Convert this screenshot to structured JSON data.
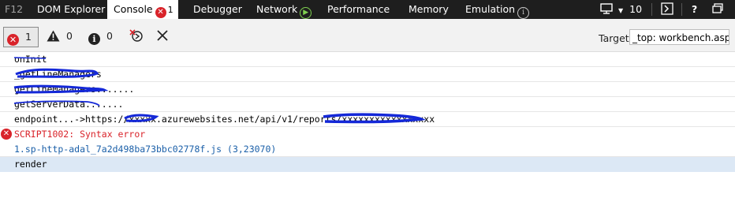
{
  "tabbar": {
    "f12": "F12",
    "tabs": [
      {
        "label": "DOM Explorer"
      },
      {
        "label": "Console",
        "count": "1"
      },
      {
        "label": "Debugger"
      },
      {
        "label": "Network"
      },
      {
        "label": "Performance"
      },
      {
        "label": "Memory"
      },
      {
        "label": "Emulation"
      }
    ],
    "device_count": "10",
    "help": "?"
  },
  "toolbar": {
    "errors_count": "1",
    "warnings_count": "0",
    "info_count": "0",
    "target_label": "Target",
    "target_value": "_top: workbench.aspx"
  },
  "console": {
    "lines": [
      {
        "text": "onInit",
        "type": "log"
      },
      {
        "text": "_getLineManagers",
        "type": "log"
      },
      {
        "text": "getLineManagers.......",
        "type": "log"
      },
      {
        "text": "getServerData.......",
        "type": "log"
      },
      {
        "text": "endpoint...->https://xxxxx.azurewebsites.net/api/v1/reports/xxxxxxxxxxxxxxxxx",
        "type": "log"
      },
      {
        "text": "SCRIPT1002: Syntax error",
        "type": "error"
      },
      {
        "text": "1.sp-http-adal_7a2d498ba73bbc02778f.js (3,23070)",
        "type": "source"
      },
      {
        "text": "render",
        "type": "log"
      }
    ]
  },
  "colors": {
    "tabbar_bg": "#1e1e1e",
    "error_red": "#d9232a",
    "link_blue": "#1a5fa8",
    "selected_row": "#dce8f5",
    "redaction_ink": "#1428d8"
  }
}
